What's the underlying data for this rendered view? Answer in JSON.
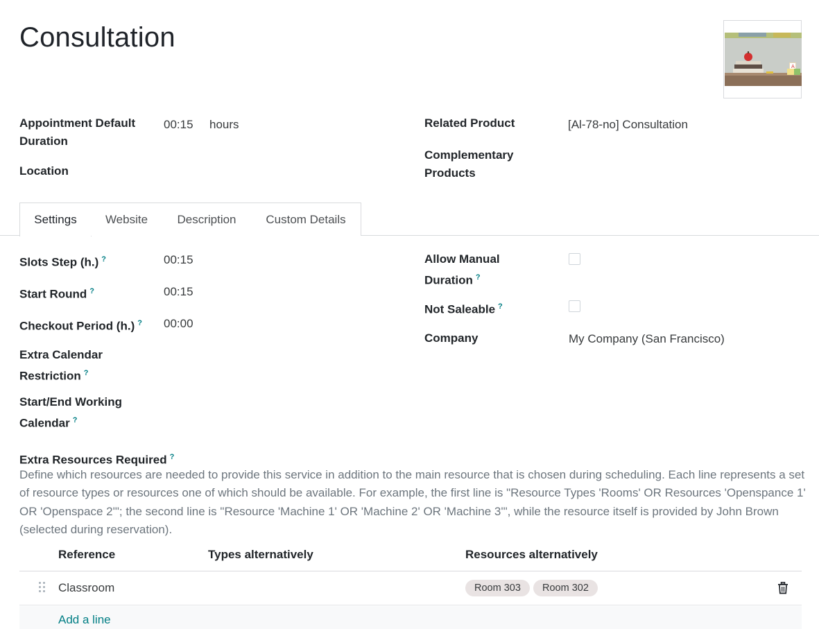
{
  "record": {
    "title": "Consultation"
  },
  "header": {
    "duration_label": "Appointment Default Duration",
    "duration_value": "00:15",
    "duration_unit": "hours",
    "location_label": "Location",
    "related_product_label": "Related Product",
    "related_product_value": "[Al-78-no] Consultation",
    "complementary_label": "Complementary Products"
  },
  "tabs": [
    {
      "label": "Settings",
      "active": true
    },
    {
      "label": "Website",
      "active": false
    },
    {
      "label": "Description",
      "active": false
    },
    {
      "label": "Custom Details",
      "active": false
    }
  ],
  "settings": {
    "slots_step_label": "Slots Step (h.)",
    "slots_step_value": "00:15",
    "start_round_label": "Start Round",
    "start_round_value": "00:15",
    "checkout_label": "Checkout Period (h.)",
    "checkout_value": "00:00",
    "extra_cal_label": "Extra Calendar Restriction",
    "start_end_label": "Start/End Working Calendar",
    "allow_manual_label": "Allow Manual Duration",
    "allow_manual_checked": false,
    "not_saleable_label": "Not Saleable",
    "not_saleable_checked": false,
    "company_label": "Company",
    "company_value": "My Company (San Francisco)",
    "help_mark": "?"
  },
  "extra_resources": {
    "label": "Extra Resources Required",
    "description": "Define which resources are needed to provide this service in addition to the main resource that is chosen during scheduling. Each line represents a set of resource types or resources one of which should be available. For example, the first line is \"Resource Types 'Rooms' OR Resources 'Openspance 1' OR 'Openspace 2'\"; the second line is \"Resource 'Machine 1' OR 'Machine 2' OR 'Machine 3'\", while the resource itself is provided by John Brown (selected during reservation).",
    "columns": [
      "Reference",
      "Types alternatively",
      "Resources alternatively"
    ],
    "rows": [
      {
        "reference": "Classroom",
        "types": "",
        "resources": [
          "Room 303",
          "Room 302"
        ]
      }
    ],
    "add_line": "Add a line"
  },
  "colors": {
    "accent": "#017e84",
    "pill_bg": "#e9e3e3",
    "border": "#d8dadd"
  },
  "icons": {
    "drag": "drag-handle-icon",
    "delete": "trash-icon",
    "help": "help-tooltip-icon"
  }
}
